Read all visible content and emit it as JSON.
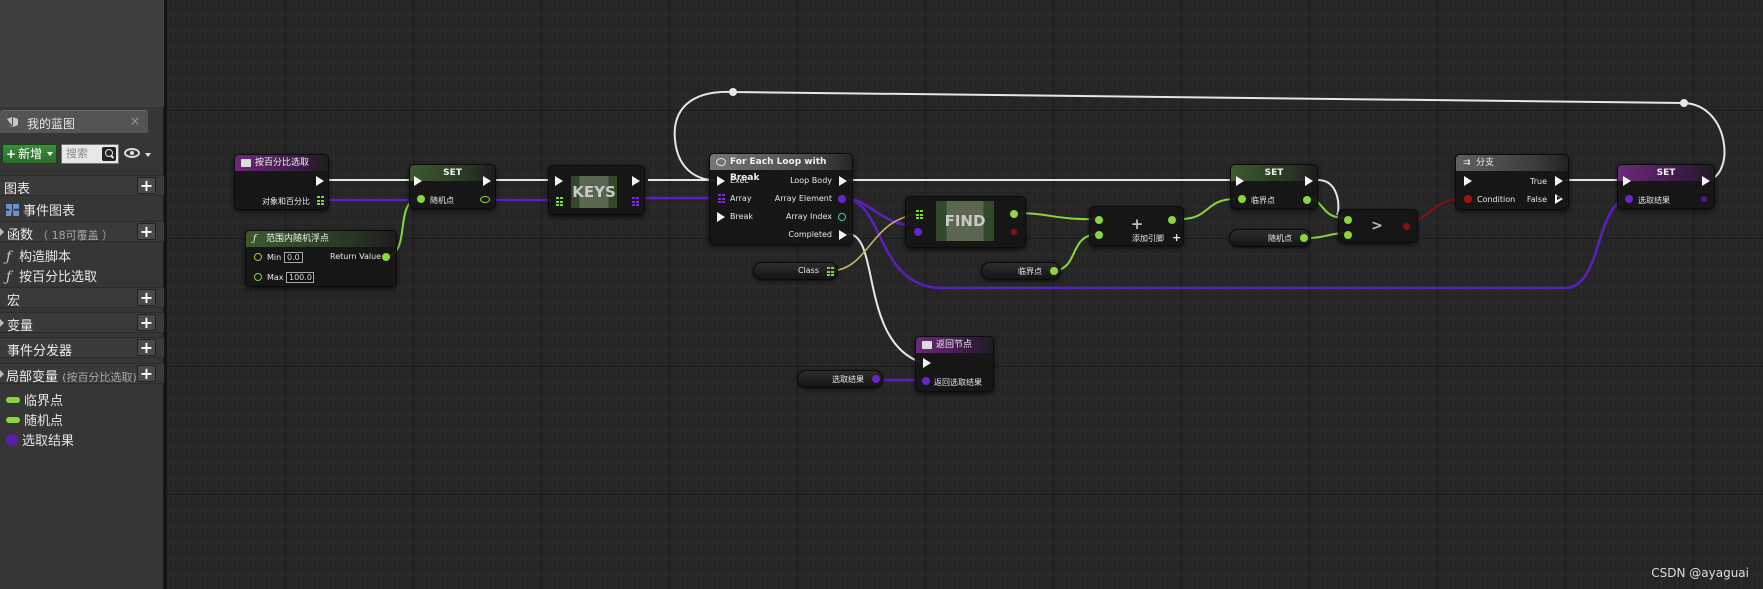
{
  "panel": {
    "tab_title": "我的蓝图",
    "tab_close": "×",
    "add_button": "新增",
    "search_placeholder": "搜索",
    "sections": {
      "graphs": "图表",
      "event_graph": "事件图表",
      "functions": "函数",
      "functions_note": "（ 18可覆盖 ）",
      "construction_script": "构造脚本",
      "function_item": "按百分比选取",
      "macros": "宏",
      "variables": "变量",
      "dispatchers": "事件分发器",
      "local_vars": "局部变量",
      "local_vars_note": "(按百分比选取)"
    },
    "local_variables": [
      {
        "name": "临界点",
        "color": "#8ad63c",
        "icon": "float-pill"
      },
      {
        "name": "随机点",
        "color": "#8ad63c",
        "icon": "float-pill"
      },
      {
        "name": "选取结果",
        "color": "#5a1ea8",
        "icon": "object-dot"
      }
    ],
    "plus": "+"
  },
  "nodes": {
    "entry": {
      "title": "按百分比选取",
      "pin": "对象和百分比"
    },
    "random": {
      "title": "范围内随机浮点",
      "min_label": "Min",
      "min_value": "0.0",
      "max_label": "Max",
      "max_value": "100.0",
      "out": "Return Value"
    },
    "set1": {
      "title": "SET",
      "pin": "随机点"
    },
    "keys": {
      "title": "KEYS"
    },
    "foreach": {
      "title": "For Each Loop with Break",
      "exec": "Exec",
      "array": "Array",
      "break": "Break",
      "loop_body": "Loop Body",
      "array_element": "Array Element",
      "array_index": "Array Index",
      "completed": "Completed"
    },
    "class_var": {
      "label": "Class"
    },
    "find": {
      "title": "FIND"
    },
    "add": {
      "title": "+",
      "add_pin": "添加引脚"
    },
    "threshold_get": {
      "label": "临界点"
    },
    "set2": {
      "title": "SET",
      "pin": "临界点"
    },
    "random_get": {
      "label": "随机点"
    },
    "compare": {
      "title": ">"
    },
    "branch": {
      "title": "分支",
      "condition": "Condition",
      "true": "True",
      "false": "False"
    },
    "set3": {
      "title": "SET",
      "pin": "选取结果"
    },
    "return": {
      "title": "返回节点",
      "pin": "返回选取结果"
    },
    "result_get": {
      "label": "选取结果"
    }
  },
  "colors": {
    "exec": "#f4f4f4",
    "float": "#8ad63c",
    "object": "#5a1ea8",
    "bool": "#8c0f0f",
    "integer": "#35d6a0"
  },
  "watermark": "CSDN @ayaguai"
}
